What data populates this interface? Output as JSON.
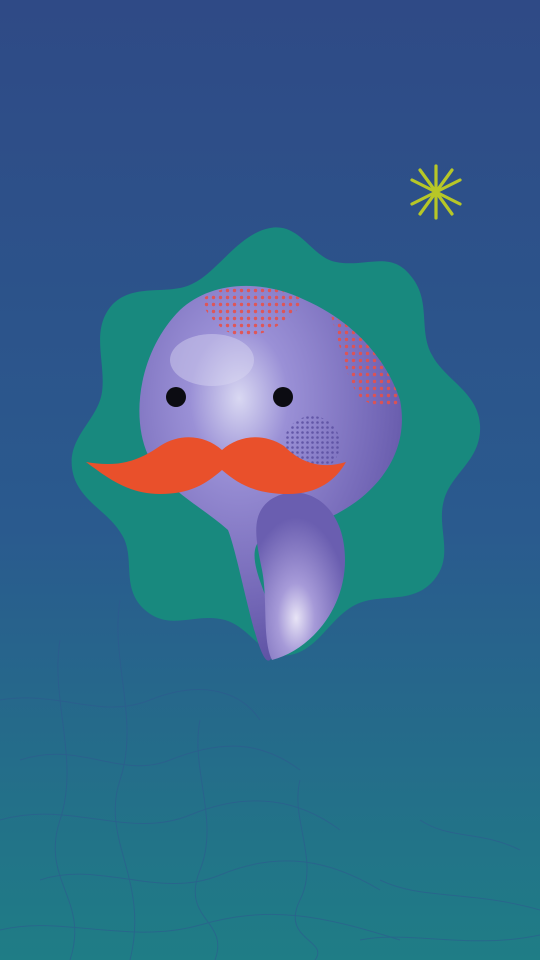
{
  "scene": {
    "subject": "character-illustration",
    "colors": {
      "background_top": "#2f4a86",
      "background_bottom": "#1f7d86",
      "blob": "#18897e",
      "character_body": "#7569b8",
      "character_highlight": "#d9d8f2",
      "character_shadow": "#5a4ea0",
      "halftone_dots": "#e6504a",
      "cheek_dots": "#5a4ea0",
      "mustache": "#e9502b",
      "eyes": "#0c0c12",
      "sparkle": "#b7c727",
      "texture_lines": "#2f5890"
    }
  }
}
